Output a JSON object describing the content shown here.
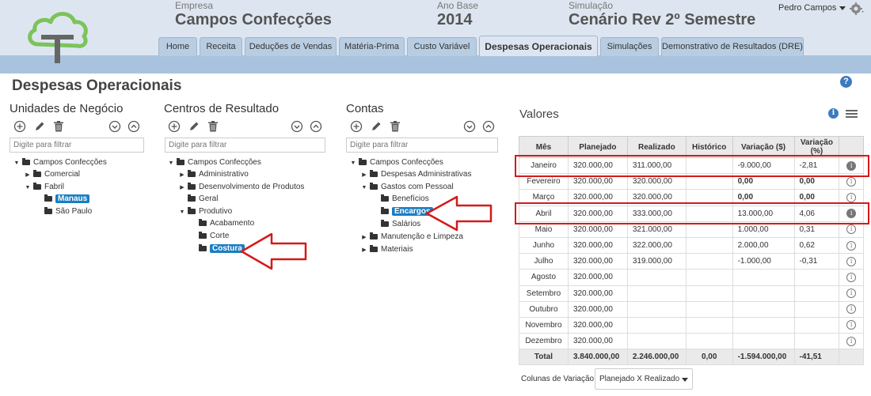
{
  "header": {
    "empresa_label": "Empresa",
    "empresa_value": "Campos Confecções",
    "ano_label": "Ano Base",
    "ano_value": "2014",
    "sim_label": "Simulação",
    "sim_value": "Cenário Rev 2º Semestre",
    "user": "Pedro Campos"
  },
  "tabs": [
    {
      "label": "Home"
    },
    {
      "label": "Receita"
    },
    {
      "label": "Deduções de Vendas"
    },
    {
      "label": "Matéria-Prima"
    },
    {
      "label": "Custo Variável"
    },
    {
      "label": "Despesas Operacionais"
    },
    {
      "label": "Simulações"
    },
    {
      "label": "Demonstrativo de Resultados (DRE)"
    }
  ],
  "page": {
    "title": "Despesas Operacionais",
    "help": "?"
  },
  "panels": {
    "unidades": {
      "title": "Unidades de Negócio",
      "filter_placeholder": "Digite para filtrar",
      "nodes": [
        "Campos Confecções",
        "Comercial",
        "Fabril",
        "Manaus",
        "São Paulo"
      ]
    },
    "centros": {
      "title": "Centros de Resultado",
      "filter_placeholder": "Digite para filtrar",
      "nodes": [
        "Campos Confecções",
        "Administrativo",
        "Desenvolvimento de Produtos",
        "Geral",
        "Produtivo",
        "Acabamento",
        "Corte",
        "Costura"
      ]
    },
    "contas": {
      "title": "Contas",
      "filter_placeholder": "Digite para filtrar",
      "nodes": [
        "Campos Confecções",
        "Despesas Administrativas",
        "Gastos com Pessoal",
        "Benefícios",
        "Encargos",
        "Salários",
        "Manutenção e Limpeza",
        "Materiais"
      ]
    }
  },
  "valores": {
    "title": "Valores",
    "columns": [
      "Mês",
      "Planejado",
      "Realizado",
      "Histórico",
      "Variação ($)",
      "Variação (%)"
    ],
    "rows": [
      {
        "mes": "Janeiro",
        "plan": "320.000,00",
        "real": "311.000,00",
        "hist": "",
        "var": "-9.000,00",
        "pct": "2,81",
        "pctsign": "-",
        "cls": "neg",
        "icon": "dark"
      },
      {
        "mes": "Fevereiro",
        "plan": "320.000,00",
        "real": "320.000,00",
        "hist": "",
        "var": "0,00",
        "pct": "0,00",
        "pctsign": "",
        "cls": "zero",
        "icon": ""
      },
      {
        "mes": "Março",
        "plan": "320.000,00",
        "real": "320.000,00",
        "hist": "",
        "var": "0,00",
        "pct": "0,00",
        "pctsign": "",
        "cls": "zero",
        "icon": ""
      },
      {
        "mes": "Abril",
        "plan": "320.000,00",
        "real": "333.000,00",
        "hist": "",
        "var": "13.000,00",
        "pct": "4,06",
        "pctsign": "",
        "cls": "pos",
        "icon": "dark"
      },
      {
        "mes": "Maio",
        "plan": "320.000,00",
        "real": "321.000,00",
        "hist": "",
        "var": "1.000,00",
        "pct": "0,31",
        "pctsign": "",
        "cls": "pos",
        "icon": ""
      },
      {
        "mes": "Junho",
        "plan": "320.000,00",
        "real": "322.000,00",
        "hist": "",
        "var": "2.000,00",
        "pct": "0,62",
        "pctsign": "",
        "cls": "pos",
        "icon": ""
      },
      {
        "mes": "Julho",
        "plan": "320.000,00",
        "real": "319.000,00",
        "hist": "",
        "var": "-1.000,00",
        "pct": "0,31",
        "pctsign": "-",
        "cls": "neg",
        "icon": ""
      },
      {
        "mes": "Agosto",
        "plan": "320.000,00",
        "real": "",
        "hist": "",
        "var": "",
        "pct": "",
        "pctsign": "",
        "cls": "",
        "icon": ""
      },
      {
        "mes": "Setembro",
        "plan": "320.000,00",
        "real": "",
        "hist": "",
        "var": "",
        "pct": "",
        "pctsign": "",
        "cls": "",
        "icon": ""
      },
      {
        "mes": "Outubro",
        "plan": "320.000,00",
        "real": "",
        "hist": "",
        "var": "",
        "pct": "",
        "pctsign": "",
        "cls": "",
        "icon": ""
      },
      {
        "mes": "Novembro",
        "plan": "320.000,00",
        "real": "",
        "hist": "",
        "var": "",
        "pct": "",
        "pctsign": "",
        "cls": "",
        "icon": ""
      },
      {
        "mes": "Dezembro",
        "plan": "320.000,00",
        "real": "",
        "hist": "",
        "var": "",
        "pct": "",
        "pctsign": "",
        "cls": "",
        "icon": ""
      }
    ],
    "total": {
      "mes": "Total",
      "plan": "3.840.000,00",
      "real": "2.246.000,00",
      "hist": "0,00",
      "var": "-1.594.000,00",
      "pct": "-41,51"
    },
    "info_glyph": "i"
  },
  "variacao": {
    "label": "Colunas de Variação:",
    "selected": "Planejado X Realizado"
  },
  "colors": {
    "accent": "#1b7dc2",
    "highlight": "#d41a1a",
    "negative": "#2a8a2a",
    "positive": "#d42020"
  }
}
